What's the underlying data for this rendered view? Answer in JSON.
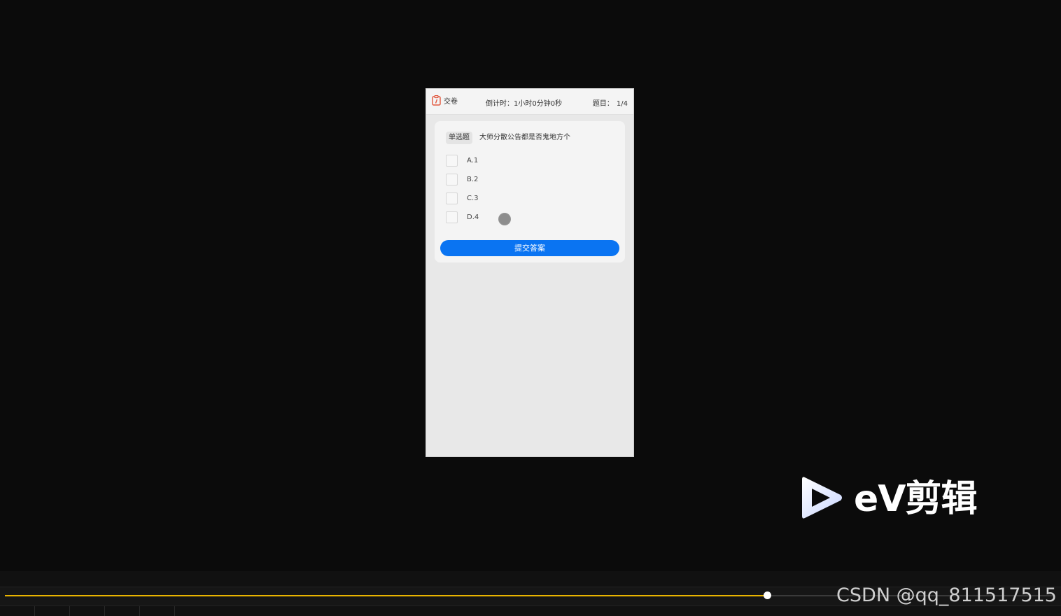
{
  "header": {
    "submit_paper_label": "交卷",
    "timer_text": "倒计时：1小时0分钟0秒",
    "question_label": "题目：",
    "question_progress": "1/4"
  },
  "question": {
    "type_badge": "单选题",
    "text": "大师分散公告都是否鬼地方个",
    "options": [
      "A.1",
      "B.2",
      "C.3",
      "D.4"
    ],
    "submit_label": "提交答案"
  },
  "colors": {
    "accent": "#0a74f2",
    "progress": "#e8b400",
    "paper_icon": "#e2583e"
  },
  "watermark": {
    "brand": "eV剪辑",
    "credit": "CSDN @qq_811517515"
  },
  "player": {
    "progress_fraction": 0.726
  }
}
